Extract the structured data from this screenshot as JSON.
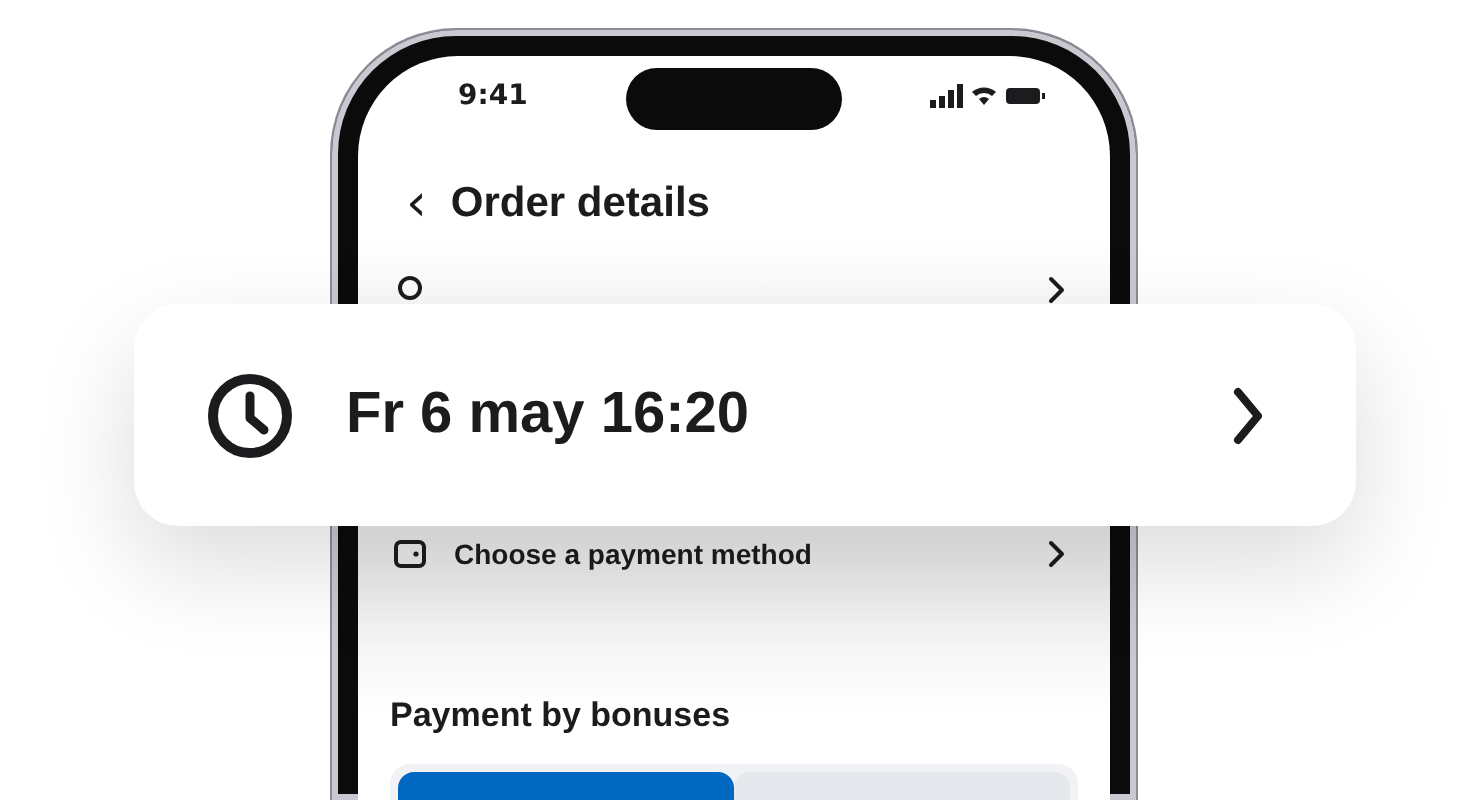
{
  "status_bar": {
    "time": "9:41"
  },
  "header": {
    "back_icon": "‹",
    "title": "Order details"
  },
  "rows": [
    {
      "kind": "location"
    },
    {
      "kind": "payment",
      "label": "Choose a payment method"
    }
  ],
  "section_title": "Payment by bonuses",
  "segments": [
    {
      "selected": true
    },
    {
      "selected": false
    }
  ],
  "time_card": {
    "label": "Fr 6 may 16:20"
  }
}
